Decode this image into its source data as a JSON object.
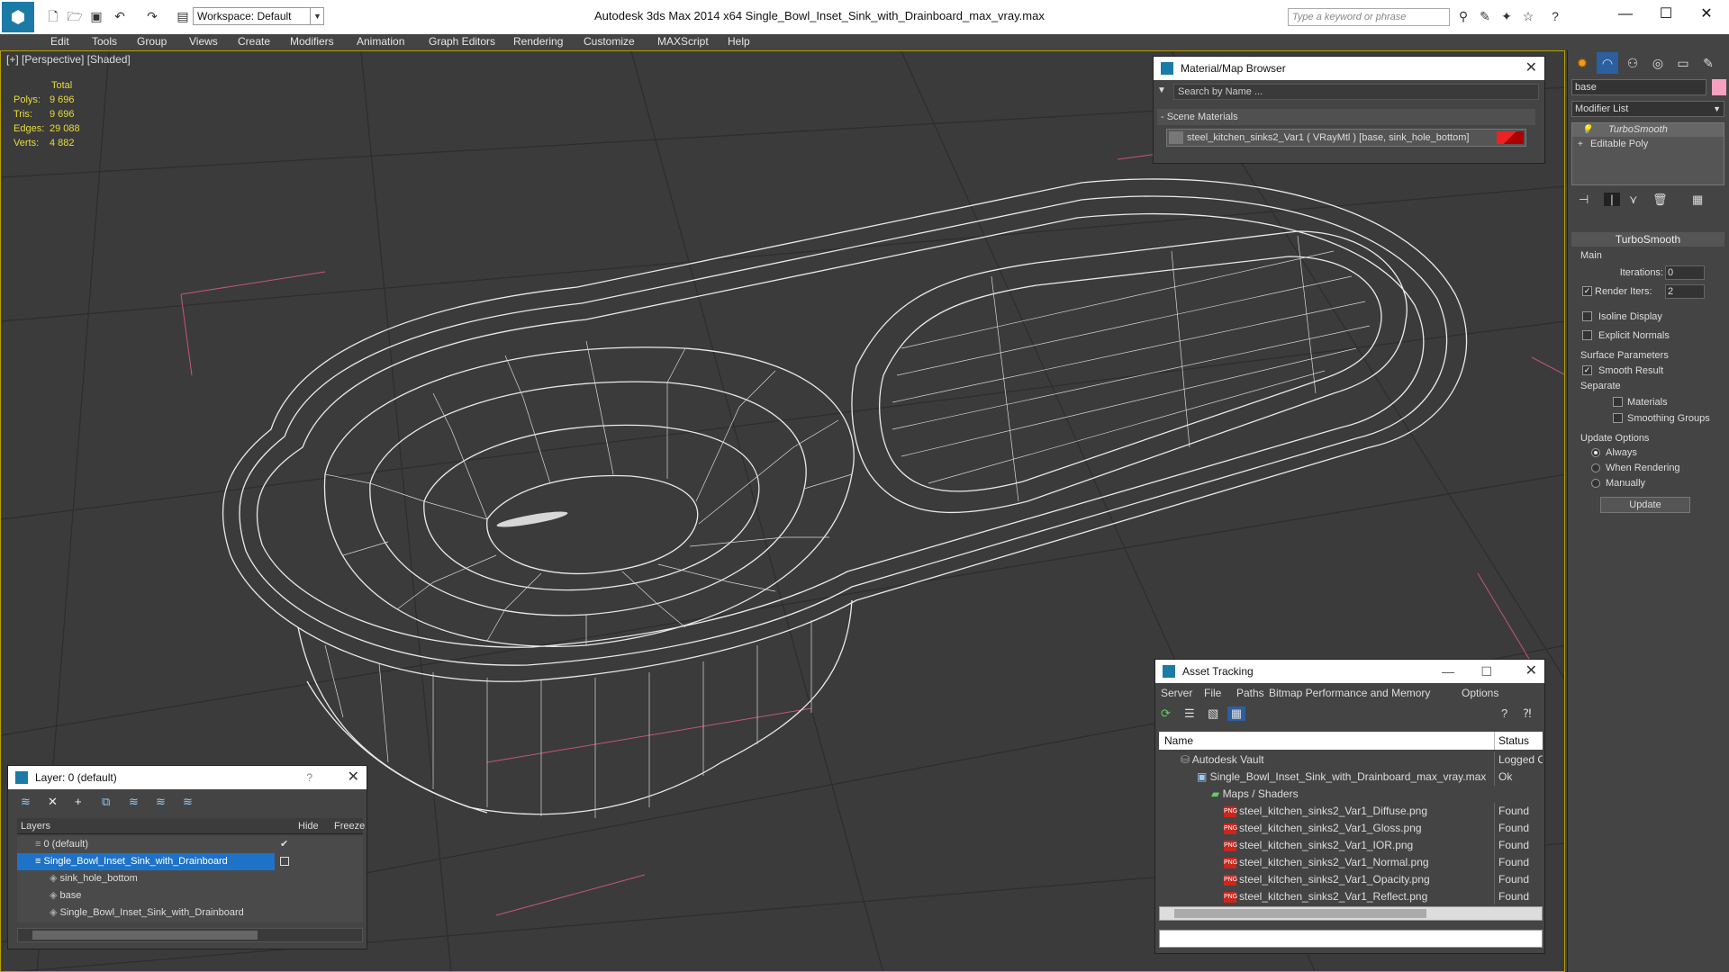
{
  "titlebar": {
    "title": "Autodesk 3ds Max  2014 x64     Single_Bowl_Inset_Sink_with_Drainboard_max_vray.max",
    "workspace": "Workspace: Default",
    "search_placeholder": "Type a keyword or phrase"
  },
  "menu": [
    "Edit",
    "Tools",
    "Group",
    "Views",
    "Create",
    "Modifiers",
    "Animation",
    "Graph Editors",
    "Rendering",
    "Customize",
    "MAXScript",
    "Help"
  ],
  "viewport": {
    "label": "[+] [Perspective] [Shaded]",
    "stats_header": "Total",
    "stats": [
      {
        "label": "Polys:",
        "value": "9 696"
      },
      {
        "label": "Tris:",
        "value": "9 696"
      },
      {
        "label": "Edges:",
        "value": "29 088"
      },
      {
        "label": "Verts:",
        "value": "4 882"
      }
    ]
  },
  "material_browser": {
    "title": "Material/Map Browser",
    "search_placeholder": "Search by Name ...",
    "section": "- Scene Materials",
    "material": "steel_kitchen_sinks2_Var1  ( VRayMtl ) [base, sink_hole_bottom]"
  },
  "command_panel": {
    "object_name": "base",
    "modifier_list": "Modifier List",
    "stack": [
      "TurboSmooth",
      "Editable Poly"
    ],
    "rollout_title": "TurboSmooth",
    "main_label": "Main",
    "iterations_label": "Iterations:",
    "iterations_value": "0",
    "render_iters_label": "Render Iters:",
    "render_iters_value": "2",
    "isoline": "Isoline Display",
    "explicit_normals": "Explicit Normals",
    "surface_params": "Surface Parameters",
    "smooth_result": "Smooth Result",
    "separate": "Separate",
    "materials": "Materials",
    "smoothing_groups": "Smoothing Groups",
    "update_options": "Update Options",
    "always": "Always",
    "when_rendering": "When Rendering",
    "manually": "Manually",
    "update_button": "Update"
  },
  "layer_dialog": {
    "title": "Layer: 0 (default)",
    "help": "?",
    "col_layers": "Layers",
    "col_hide": "Hide",
    "col_freeze": "Freeze",
    "rows": [
      {
        "name": "0 (default)",
        "indent": 1
      },
      {
        "name": "Single_Bowl_Inset_Sink_with_Drainboard",
        "indent": 1,
        "selected": true
      },
      {
        "name": "sink_hole_bottom",
        "indent": 2
      },
      {
        "name": "base",
        "indent": 2
      },
      {
        "name": "Single_Bowl_Inset_Sink_with_Drainboard",
        "indent": 2
      }
    ]
  },
  "asset_tracking": {
    "title": "Asset Tracking",
    "menu": [
      "Server",
      "File",
      "Paths",
      "Bitmap Performance and Memory",
      "Options"
    ],
    "col_name": "Name",
    "col_status": "Status",
    "rows": [
      {
        "name": "Autodesk Vault",
        "status": "Logged O",
        "indent": 1
      },
      {
        "name": "Single_Bowl_Inset_Sink_with_Drainboard_max_vray.max",
        "status": "Ok",
        "indent": 2
      },
      {
        "name": "Maps / Shaders",
        "status": "",
        "indent": 3
      },
      {
        "name": "steel_kitchen_sinks2_Var1_Diffuse.png",
        "status": "Found",
        "indent": 4,
        "png": true
      },
      {
        "name": "steel_kitchen_sinks2_Var1_Gloss.png",
        "status": "Found",
        "indent": 4,
        "png": true
      },
      {
        "name": "steel_kitchen_sinks2_Var1_IOR.png",
        "status": "Found",
        "indent": 4,
        "png": true
      },
      {
        "name": "steel_kitchen_sinks2_Var1_Normal.png",
        "status": "Found",
        "indent": 4,
        "png": true
      },
      {
        "name": "steel_kitchen_sinks2_Var1_Opacity.png",
        "status": "Found",
        "indent": 4,
        "png": true
      },
      {
        "name": "steel_kitchen_sinks2_Var1_Reflect.png",
        "status": "Found",
        "indent": 4,
        "png": true
      }
    ]
  }
}
